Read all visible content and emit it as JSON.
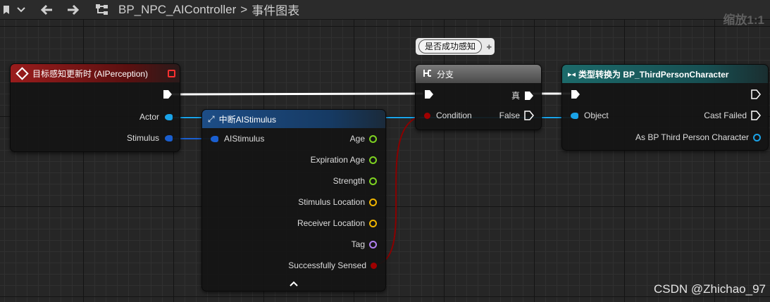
{
  "topbar": {
    "breadcrumb_blueprint": "BP_NPC_AIController",
    "breadcrumb_sep": ">",
    "breadcrumb_graph": "事件图表",
    "zoom": "缩放1:1"
  },
  "comment": {
    "text": "是否成功感知"
  },
  "nodes": {
    "perception": {
      "title": "目标感知更新时 (AIPerception)",
      "header_color": "#8a1a1a",
      "pins": {
        "actor": "Actor",
        "stimulus": "Stimulus"
      }
    },
    "break_stimulus": {
      "title": "中断AIStimulus",
      "header_color": "#1d4d86",
      "input": "AIStimulus",
      "outputs": [
        "Age",
        "Expiration Age",
        "Strength",
        "Stimulus Location",
        "Receiver Location",
        "Tag",
        "Successfully Sensed"
      ]
    },
    "branch": {
      "title": "分支",
      "header_color": "#5a5a5a",
      "condition": "Condition",
      "true_label": "真",
      "false_label": "False"
    },
    "cast": {
      "title": "类型转换为 BP_ThirdPersonCharacter",
      "header_color": "#1a6a6a",
      "object": "Object",
      "cast_failed": "Cast Failed",
      "as_output": "As BP Third Person Character"
    }
  },
  "watermark": "CSDN @Zhichao_97",
  "colors": {
    "exec": "#ffffff",
    "object_pin": "#1aa3e8",
    "struct_pin": "#1a5fd0",
    "float_pin": "#7ed321",
    "vector_pin": "#f0b400",
    "name_pin": "#b080f0",
    "bool_pin": "#a00000"
  }
}
